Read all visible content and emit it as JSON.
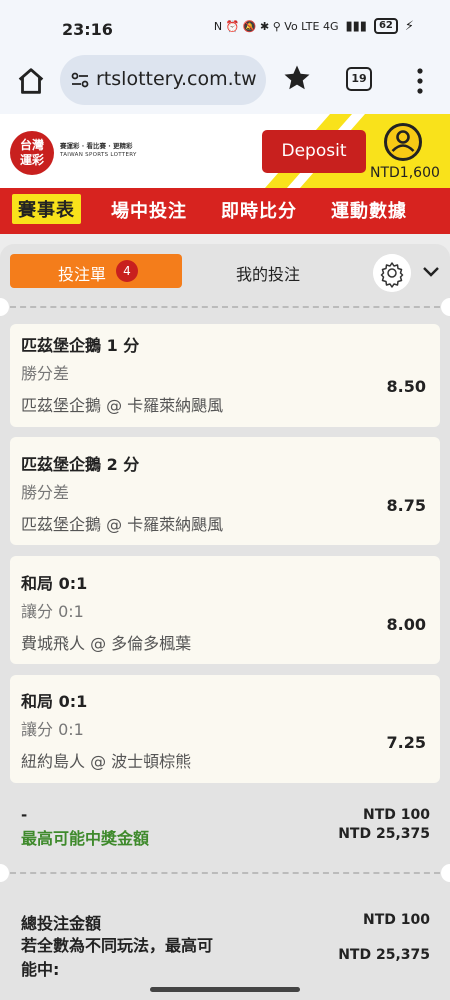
{
  "status_bar": {
    "time": "23:16",
    "indicators": "N ⏰ 🔕 ✱ ⚲ Vo LTE 4G",
    "battery": "62"
  },
  "browser": {
    "url": "rtslottery.com.tw",
    "tab_count": "19"
  },
  "site": {
    "logo_text": "台灣\n運彩",
    "logo_tagline": "賽運彩 · 看比賽 · 更精彩",
    "logo_english": "TAIWAN SPORTS LOTTERY",
    "deposit_label": "Deposit",
    "balance": "NTD1,600",
    "brand_red": "#c8201e",
    "brand_yellow": "#f9e21b"
  },
  "nav": {
    "items": [
      "賽事表",
      "場中投注",
      "即時比分",
      "運動數據"
    ],
    "active_index": 0
  },
  "slip": {
    "tab_label": "投注單",
    "tab_badge": "4",
    "my_bets_label": "我的投注",
    "accent": "#f47d1b",
    "bets": [
      {
        "selection": "匹茲堡企鵝 1 分",
        "market": "勝分差",
        "match": "匹茲堡企鵝 @ 卡羅萊納颶風",
        "odds": "8.50"
      },
      {
        "selection": "匹茲堡企鵝 2 分",
        "market": "勝分差",
        "match": "匹茲堡企鵝 @ 卡羅萊納颶風",
        "odds": "8.75"
      },
      {
        "selection": "和局 0:1",
        "market": "讓分 0:1",
        "match": "費城飛人 @ 多倫多楓葉",
        "odds": "8.00"
      },
      {
        "selection": "和局 0:1",
        "market": "讓分 0:1",
        "match": "紐約島人 @ 波士頓棕熊",
        "odds": "7.25"
      }
    ],
    "summary": {
      "dash": "-",
      "max_win_label": "最高可能中獎金額",
      "stake": "NTD 100",
      "max_win": "NTD 25,375"
    },
    "totals": {
      "total_stake_label": "總投注金額",
      "total_stake": "NTD 100",
      "all_diff_label": "若全數為不同玩法，最高可能中:",
      "all_diff_value": "NTD 25,375"
    }
  }
}
